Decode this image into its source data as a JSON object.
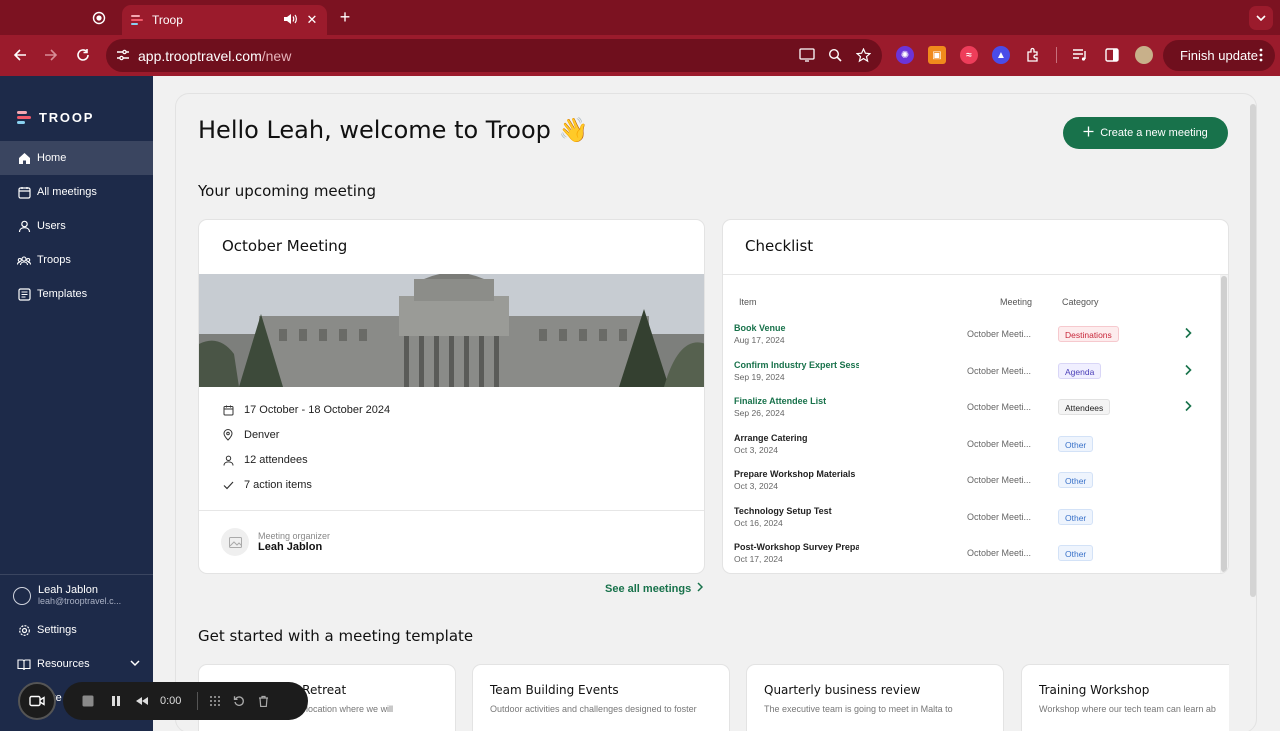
{
  "browser": {
    "tab_title": "Troop",
    "new_tab": "+",
    "close_tab": "✕",
    "url_host": "app.trooptravel.com",
    "url_path": "/new",
    "finish_update": "Finish update"
  },
  "sidebar": {
    "logo": "TROOP",
    "items": [
      {
        "label": "Home",
        "icon": "home-icon"
      },
      {
        "label": "All meetings",
        "icon": "calendar-icon"
      },
      {
        "label": "Users",
        "icon": "user-icon"
      },
      {
        "label": "Troops",
        "icon": "group-icon"
      },
      {
        "label": "Templates",
        "icon": "template-icon"
      }
    ],
    "user_name": "Leah Jablon",
    "user_email": "leah@trooptravel.c...",
    "settings": "Settings",
    "resources": "Resources",
    "more_partial": "re"
  },
  "main": {
    "greeting": "Hello Leah, welcome to Troop 👋",
    "create_button": "Create a new meeting",
    "upcoming_heading": "Your upcoming meeting",
    "meeting": {
      "title": "October Meeting",
      "dates": "17 October - 18 October 2024",
      "location": "Denver",
      "attendees": "12 attendees",
      "actions": "7 action items",
      "organizer_label": "Meeting organizer",
      "organizer_name": "Leah Jablon"
    },
    "see_all": "See all meetings",
    "checklist": {
      "title": "Checklist",
      "col_item": "Item",
      "col_meeting": "Meeting",
      "col_category": "Category",
      "rows": [
        {
          "item": "Book Venue",
          "date": "Aug 17, 2024",
          "meeting": "October Meeti...",
          "category": "Destinations"
        },
        {
          "item": "Confirm Industry Expert Sessi",
          "date": "Sep 19, 2024",
          "meeting": "October Meeti...",
          "category": "Agenda"
        },
        {
          "item": "Finalize Attendee List",
          "date": "Sep 26, 2024",
          "meeting": "October Meeti...",
          "category": "Attendees"
        },
        {
          "item": "Arrange Catering",
          "date": "Oct 3, 2024",
          "meeting": "October Meeti...",
          "category": "Other"
        },
        {
          "item": "Prepare Workshop Materials",
          "date": "Oct 3, 2024",
          "meeting": "October Meeti...",
          "category": "Other"
        },
        {
          "item": "Technology Setup Test",
          "date": "Oct 16, 2024",
          "meeting": "October Meeti...",
          "category": "Other"
        },
        {
          "item": "Post-Workshop Survey Prepa",
          "date": "Oct 17, 2024",
          "meeting": "October Meeti...",
          "category": "Other"
        }
      ]
    },
    "templates_heading": "Get started with a meeting template",
    "templates": [
      {
        "title": "mpany Retreat",
        "desc": "n a scenic location where we will"
      },
      {
        "title": "Team Building Events",
        "desc": "Outdoor activities and challenges designed to foster"
      },
      {
        "title": "Quarterly business review",
        "desc": "The executive team is going to meet in Malta to"
      },
      {
        "title": "Training Workshop",
        "desc": "Workshop where our tech team can learn ab"
      }
    ]
  },
  "recorder": {
    "time": "0:00"
  },
  "colors": {
    "brand_green": "#18724b",
    "sidebar_bg": "#1d2a49",
    "chrome_bg": "#9b1b2c"
  }
}
